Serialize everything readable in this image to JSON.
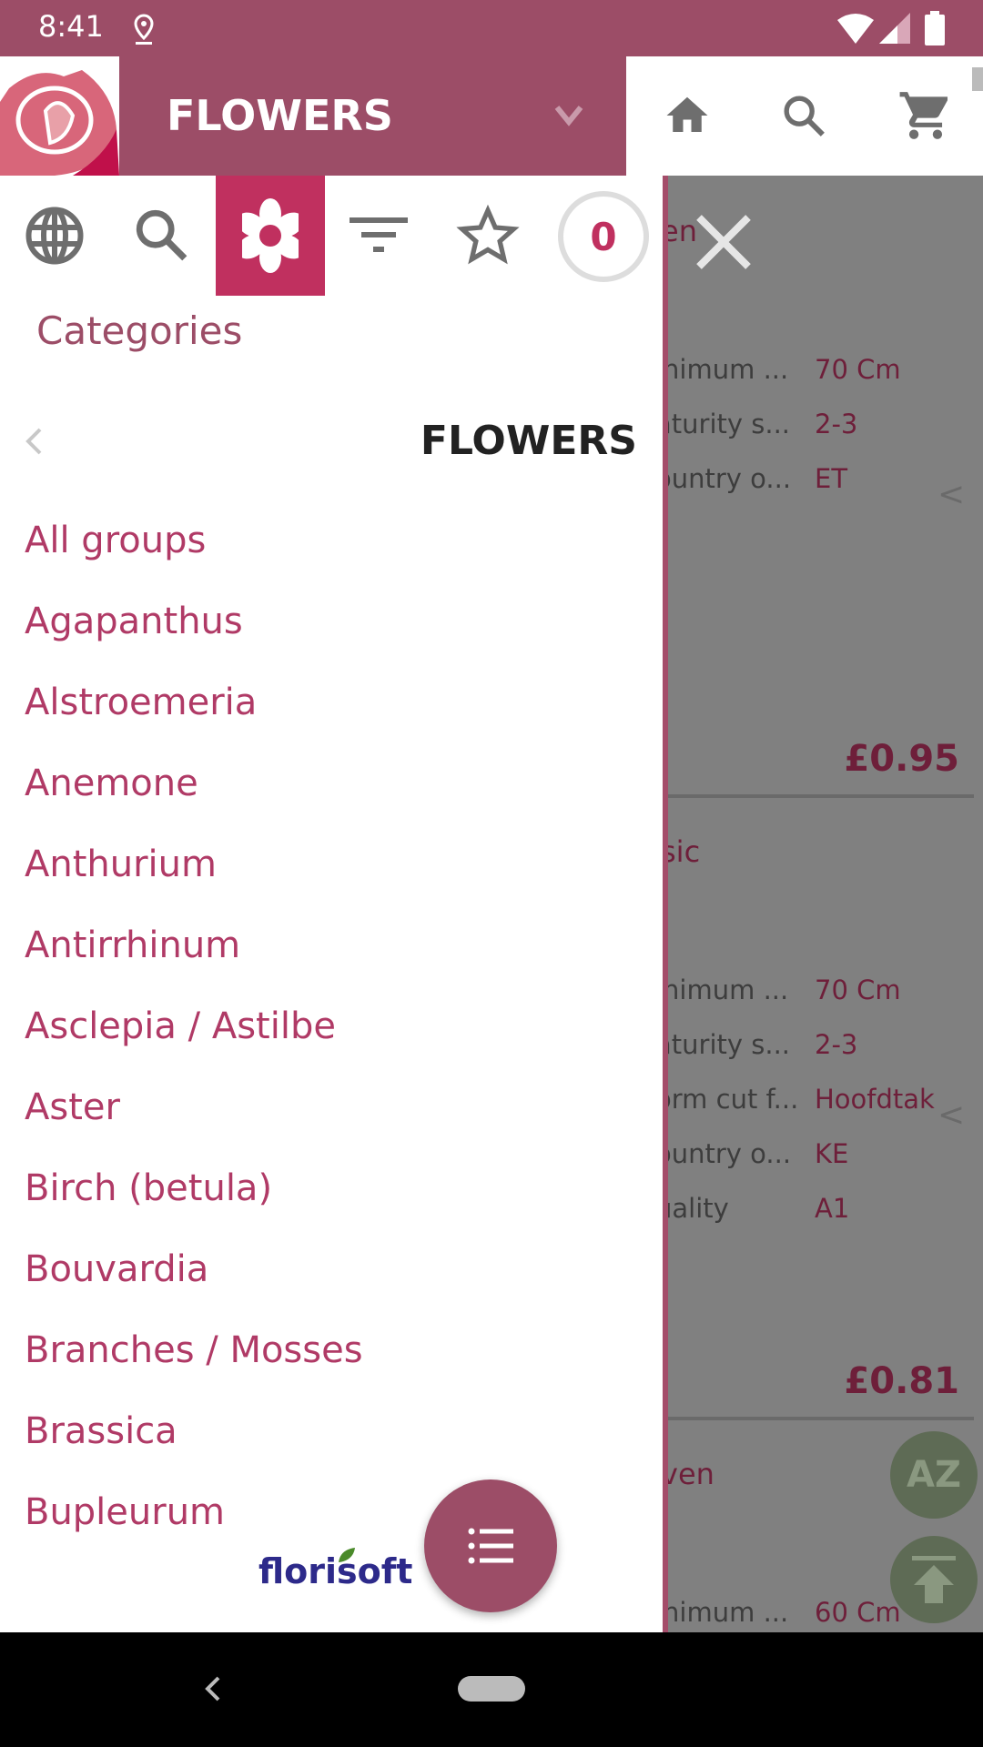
{
  "status": {
    "time": "8:41"
  },
  "appbar": {
    "title": "FLOWERS"
  },
  "drawer": {
    "count": "0",
    "heading": "Categories",
    "section": "FLOWERS",
    "items": [
      "All groups",
      "Agapanthus",
      "Alstroemeria",
      "Anemone",
      "Anthurium",
      "Antirrhinum",
      "Asclepia / Astilbe",
      "Aster",
      "Birch (betula)",
      "Bouvardia",
      "Branches / Mosses",
      "Brassica",
      "Bupleurum"
    ],
    "brand": "florisoft"
  },
  "colors": {
    "primary": "#9c4d67",
    "accent": "#c0305f",
    "item": "#b03a66"
  },
  "background": {
    "card1": {
      "title": "en",
      "rows": [
        [
          "inimum ...",
          "70 Cm"
        ],
        [
          "aturity s...",
          "2-3"
        ],
        [
          "ountry o...",
          "ET"
        ]
      ],
      "price": "£0.95"
    },
    "card2": {
      "title": "sic",
      "rows": [
        [
          "inimum ...",
          "70 Cm"
        ],
        [
          "aturity s...",
          "2-3"
        ],
        [
          "orm cut f...",
          "Hoofdtak"
        ],
        [
          "ountry o...",
          "KE"
        ],
        [
          "uality",
          "A1"
        ]
      ],
      "price": "£0.81"
    },
    "card3": {
      "title": "ven",
      "rows": [
        [
          "inimum ...",
          "60 Cm"
        ]
      ]
    },
    "sort_label": "AZ"
  }
}
